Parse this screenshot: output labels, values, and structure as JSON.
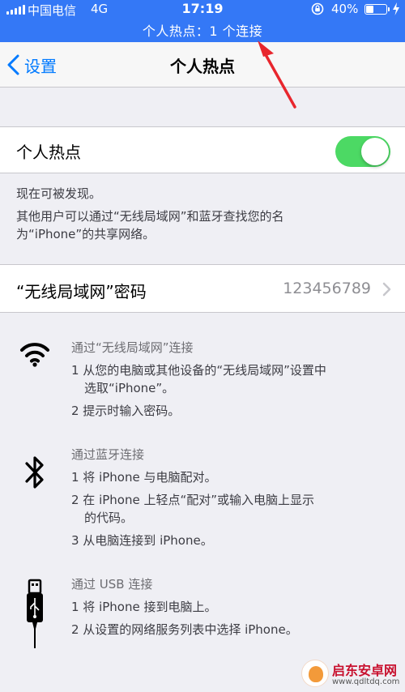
{
  "status_bar": {
    "carrier": "中国电信",
    "network": "4G",
    "time": "17:19",
    "battery_percent": "40%",
    "battery_level": 0.4,
    "hotspot_banner": "个人热点：1 个连接",
    "background_color": "#3478f6"
  },
  "nav": {
    "back_label": "设置",
    "title": "个人热点"
  },
  "hotspot_toggle": {
    "label": "个人热点",
    "enabled": true,
    "on_color": "#4cd964"
  },
  "hotspot_notes": {
    "discoverable": "现在可被发现。",
    "line1": "其他用户可以通过“无线局域网”和蓝牙查找您的名",
    "line2": "为“iPhone”的共享网络。"
  },
  "wifi_password": {
    "label": "“无线局域网”密码",
    "value": "123456789"
  },
  "guides": {
    "wifi": {
      "icon": "wifi-icon",
      "title": "通过“无线局域网”连接",
      "steps": [
        "1 从您的电脑或其他设备的“无线局域网”设置中",
        "选取“iPhone”。",
        "2 提示时输入密码。"
      ]
    },
    "bluetooth": {
      "icon": "bluetooth-icon",
      "title": "通过蓝牙连接",
      "steps": [
        "1 将 iPhone 与电脑配对。",
        "2 在 iPhone 上轻点“配对”或输入电脑上显示",
        "的代码。",
        "3 从电脑连接到 iPhone。"
      ]
    },
    "usb": {
      "icon": "usb-cable-icon",
      "title": "通过 USB 连接",
      "steps": [
        "1 将 iPhone 接到电脑上。",
        "2 从设置的网络服务列表中选择 iPhone。"
      ]
    }
  },
  "watermark": {
    "name": "启东安卓网",
    "url": "www.qdltdq.com"
  },
  "colors": {
    "ios_blue": "#007aff",
    "annotation_red": "#e8262d"
  }
}
